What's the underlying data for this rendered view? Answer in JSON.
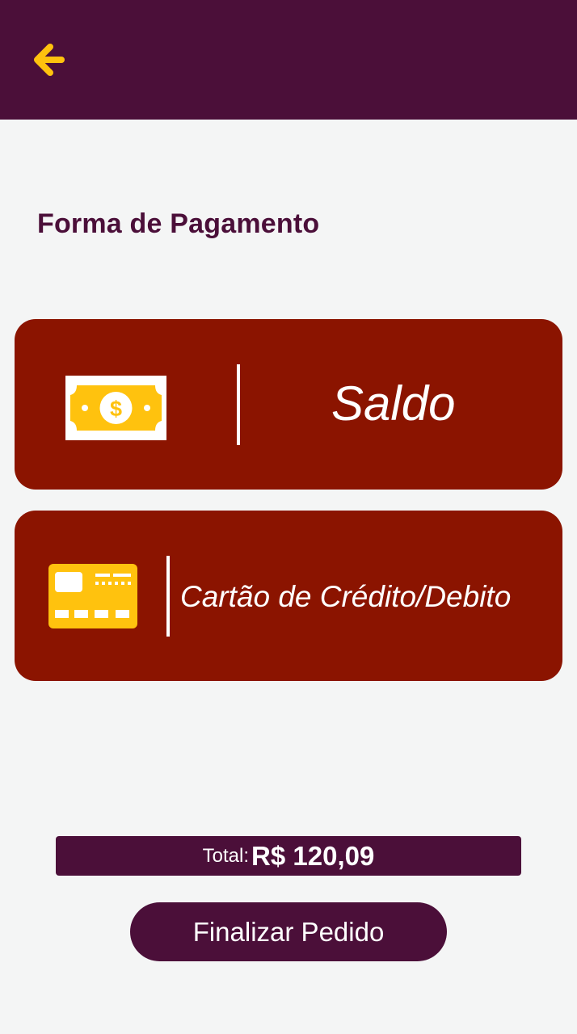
{
  "header": {
    "back_icon": "arrow-left-icon",
    "accent_color": "#ffc20e",
    "background_color": "#4b0f39"
  },
  "page": {
    "title": "Forma de Pagamento"
  },
  "payment_options": [
    {
      "label": "Saldo",
      "icon": "money-bill-icon"
    },
    {
      "label": "Cartão de Crédito/Debito",
      "icon": "credit-card-icon"
    }
  ],
  "colors": {
    "card_background": "#8b1400",
    "icon_yellow": "#ffc20e",
    "primary": "#4b0f39",
    "page_background": "#f4f5f5"
  },
  "summary": {
    "total_label": "Total:",
    "total_value": "R$ 120,09"
  },
  "actions": {
    "finish_label": "Finalizar Pedido"
  }
}
